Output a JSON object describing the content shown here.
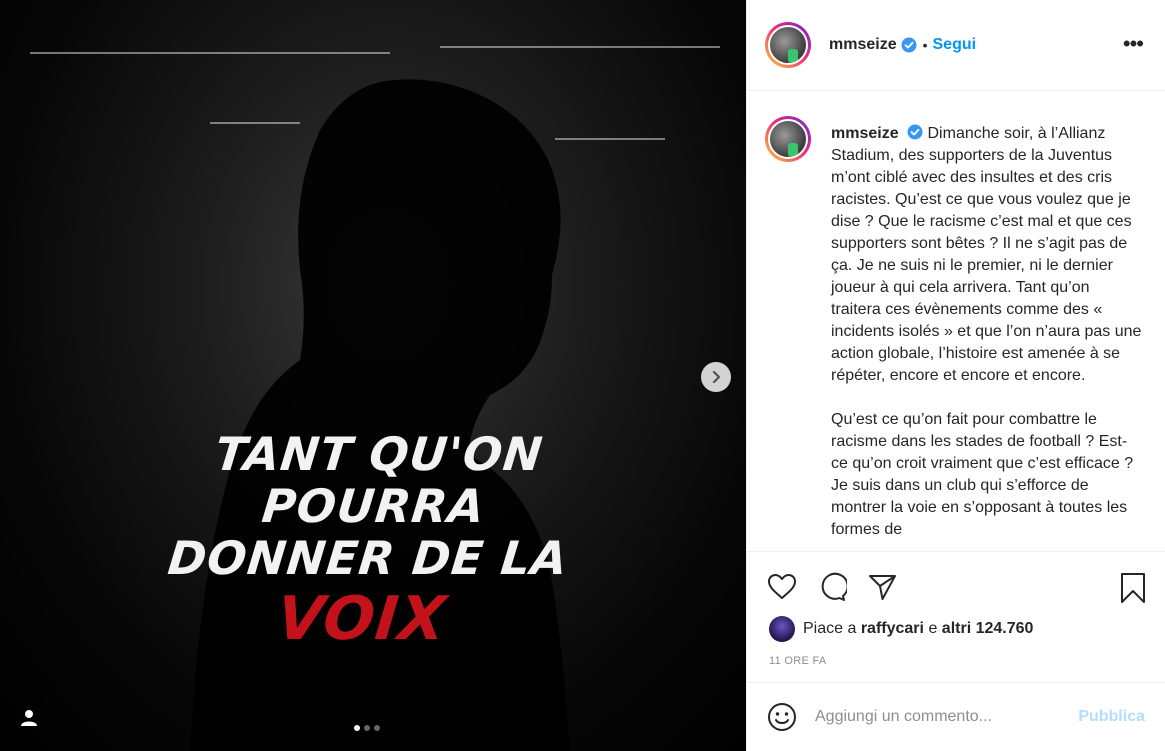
{
  "post": {
    "username": "mmseize",
    "follow_separator": "•",
    "follow_label": "Segui",
    "more_label": "•••",
    "poster": {
      "line1": "TANT QU'ON POURRA",
      "line2": "DONNER DE LA",
      "line3": "VOIX"
    },
    "carousel": {
      "total": 3,
      "active": 1
    }
  },
  "caption": {
    "username": "mmseize",
    "paragraph1": "Dimanche soir, à l’Allianz Stadium, des supporters de la Juventus m’ont ciblé avec des insultes et des cris racistes. Qu’est ce que vous voulez que je dise ? Que le racisme c’est mal et que ces supporters sont bêtes ? Il ne s’agit pas de ça. Je ne suis ni le premier, ni le dernier joueur à qui cela arrivera. Tant qu’on traitera ces évènements comme des « incidents isolés » et que l’on n’aura pas une action globale, l’histoire est amenée à se répéter, encore et encore et encore.",
    "paragraph2": "Qu’est ce qu’on fait pour combattre le racisme dans les stades de football ? Est-ce qu’on croit vraiment que c’est efficace ? Je suis dans un club qui s’efforce de montrer la voie en s’opposant à toutes les formes de"
  },
  "likes": {
    "prefix": "Piace a",
    "user": "raffycari",
    "connector": "e",
    "others": "altri 124.760"
  },
  "timestamp": "11 ORE FA",
  "comment": {
    "placeholder": "Aggiungi un commento...",
    "publish_label": "Pubblica"
  },
  "colors": {
    "accent": "#0095f6",
    "publish_disabled": "#b2dffc",
    "poster_red": "#c4121a",
    "muted": "#8e8e8e"
  }
}
